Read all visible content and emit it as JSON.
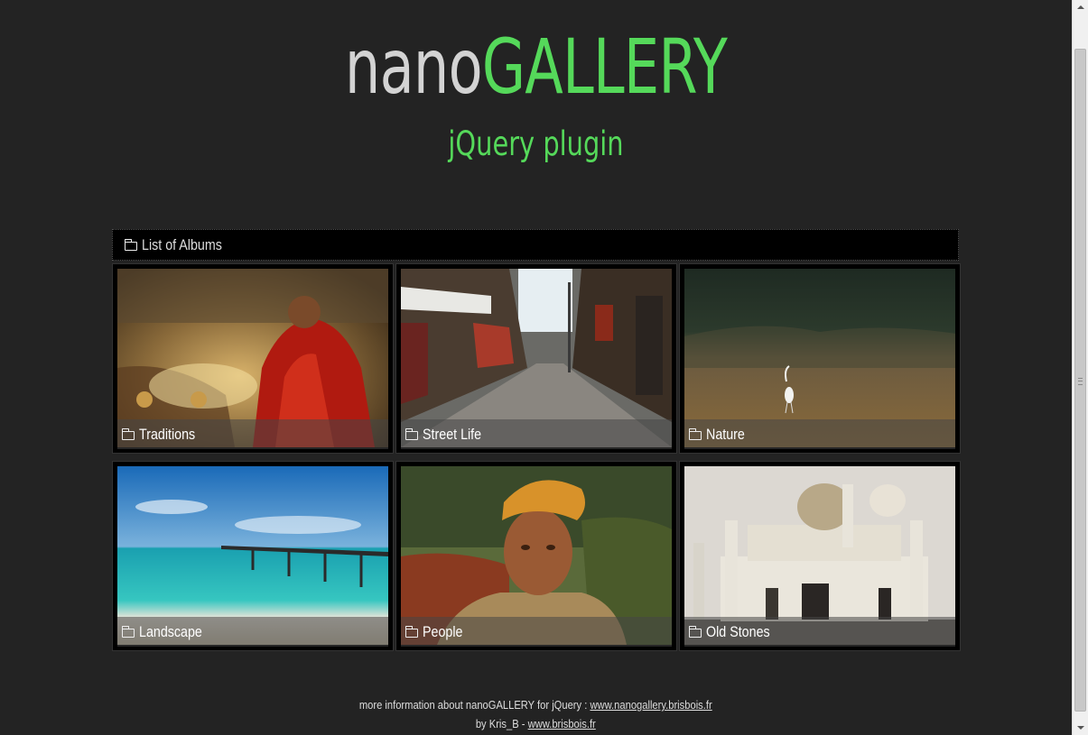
{
  "header": {
    "title_part1": "nano",
    "title_part2": "GALLERY",
    "subtitle": "jQuery plugin"
  },
  "breadcrumb": {
    "icon": "folder-icon",
    "label": "List of Albums"
  },
  "albums": [
    {
      "label": "Traditions",
      "icon": "folder-icon"
    },
    {
      "label": "Street Life",
      "icon": "folder-icon"
    },
    {
      "label": "Nature",
      "icon": "folder-icon"
    },
    {
      "label": "Landscape",
      "icon": "folder-icon"
    },
    {
      "label": "People",
      "icon": "folder-icon"
    },
    {
      "label": "Old Stones",
      "icon": "folder-icon"
    }
  ],
  "footer": {
    "line1_text": "more information about nanoGALLERY for jQuery : ",
    "line1_link": "www.nanogallery.brisbois.fr",
    "line2_text": "by Kris_B - ",
    "line2_link": "www.brisbois.fr"
  },
  "colors": {
    "background": "#232323",
    "accent_green": "#55d95a",
    "title_gray": "#d3d3d3"
  }
}
